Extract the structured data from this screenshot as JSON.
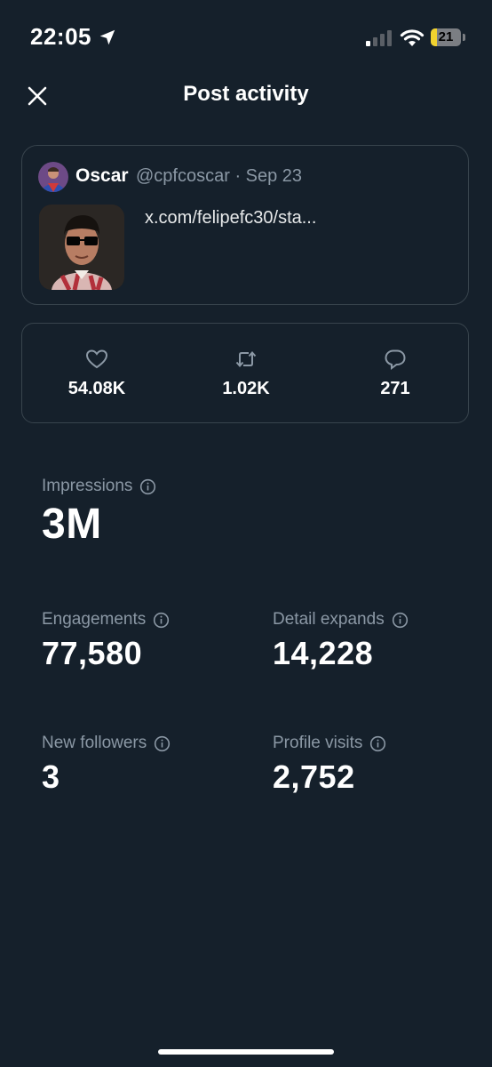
{
  "status_bar": {
    "time": "22:05",
    "battery_level": "21",
    "battery_fraction": 0.21
  },
  "header": {
    "title": "Post activity"
  },
  "post": {
    "author_name": "Oscar",
    "meta": "@cpfcoscar · Sep 23",
    "link_text": "x.com/felipefc30/sta..."
  },
  "engagement_bar": {
    "likes": "54.08K",
    "reposts": "1.02K",
    "replies": "271"
  },
  "metrics": {
    "impressions": {
      "label": "Impressions",
      "value": "3M"
    },
    "engagements": {
      "label": "Engagements",
      "value": "77,580"
    },
    "detail_expands": {
      "label": "Detail expands",
      "value": "14,228"
    },
    "new_followers": {
      "label": "New followers",
      "value": "3"
    },
    "profile_visits": {
      "label": "Profile visits",
      "value": "2,752"
    }
  },
  "colors": {
    "background": "#15202b",
    "border": "#38444d",
    "muted_text": "#8b98a5",
    "battery": "#f1d22f"
  }
}
